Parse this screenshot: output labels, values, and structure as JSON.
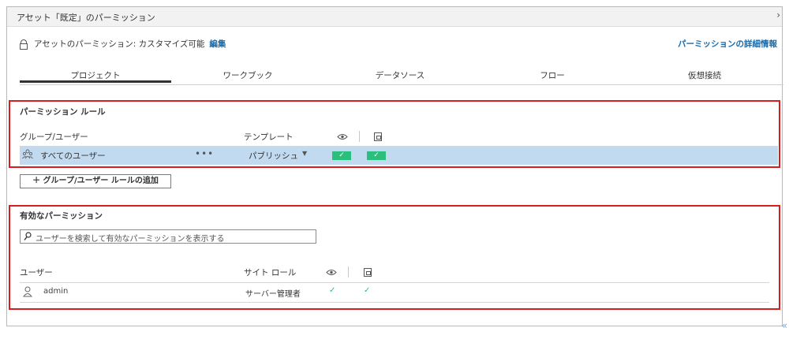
{
  "header": {
    "title": "アセット「既定」のパーミッション",
    "chevron_icon": "chevron-right-icon"
  },
  "permission_line": {
    "text": "アセットのパーミッション: カスタマイズ可能",
    "edit_link": "編集",
    "detail_link": "パーミッションの詳細情報"
  },
  "tabs": [
    {
      "label": "プロジェクト",
      "selected": true
    },
    {
      "label": "ワークブック",
      "selected": false
    },
    {
      "label": "データソース",
      "selected": false
    },
    {
      "label": "フロー",
      "selected": false
    },
    {
      "label": "仮想接続",
      "selected": false
    }
  ],
  "rules": {
    "title": "パーミッション ルール",
    "columns": {
      "group_user": "グループ/ユーザー",
      "template": "テンプレート"
    },
    "rows": [
      {
        "name": "すべてのユーザー",
        "more": "•••",
        "template": "パブリッシュ",
        "view": "✓",
        "save": "✓"
      }
    ],
    "add_button": "＋ グループ/ユーザー ルールの追加"
  },
  "effective": {
    "title": "有効なパーミッション",
    "search_placeholder": "ユーザーを検索して有効なパーミッションを表示する",
    "columns": {
      "user": "ユーザー",
      "site_role": "サイト ロール"
    },
    "rows": [
      {
        "name": "admin",
        "role": "サーバー管理者",
        "view": "✓",
        "save": "✓"
      }
    ]
  },
  "colors": {
    "accent_link": "#1a6aa8",
    "highlight_row": "#c2daf0",
    "check_green": "#2bbf7e",
    "annotation_red": "#d71d1d"
  }
}
